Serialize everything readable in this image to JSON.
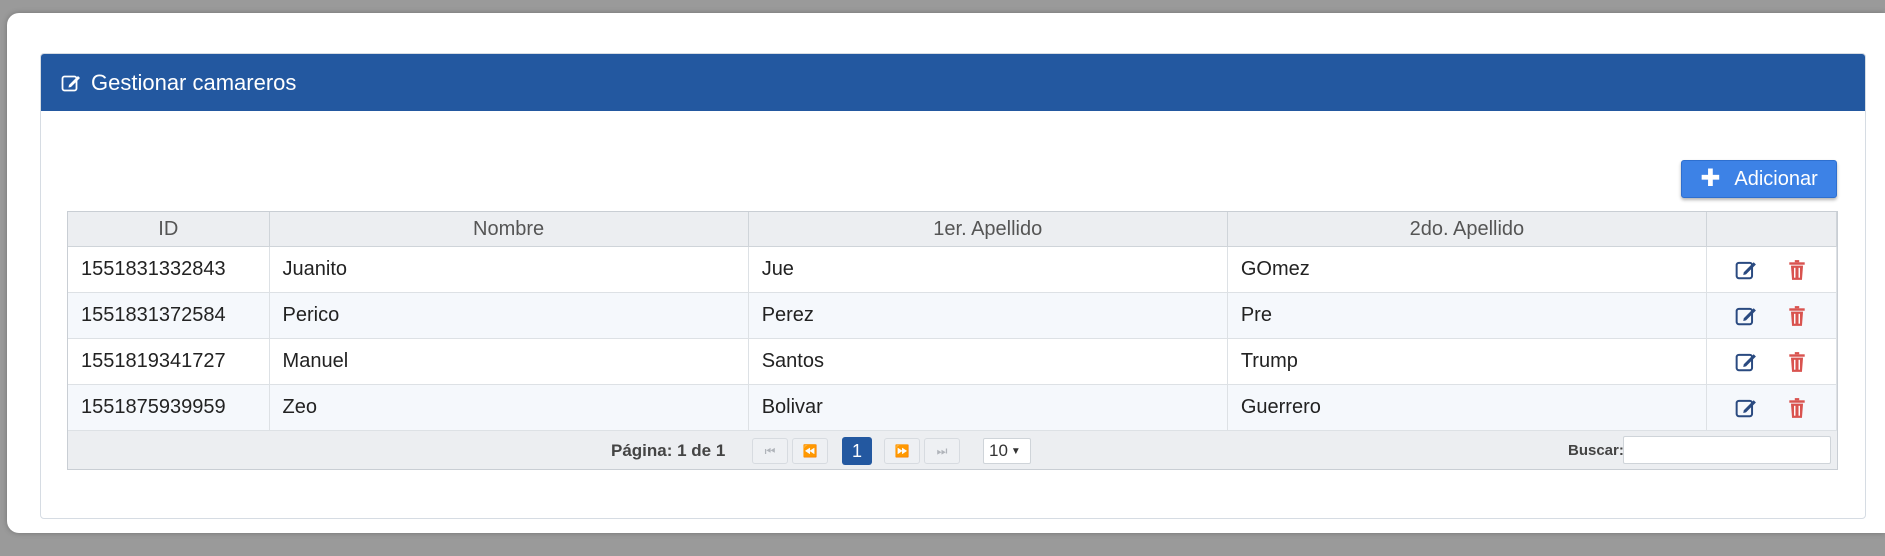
{
  "header": {
    "title": "Gestionar camareros",
    "icon": "edit-icon"
  },
  "toolbar": {
    "add_label": "Adicionar",
    "add_icon": "plus-icon"
  },
  "table": {
    "columns": [
      "ID",
      "Nombre",
      "1er. Apellido",
      "2do. Apellido",
      ""
    ],
    "rows": [
      {
        "id": "1551831332843",
        "nombre": "Juanito",
        "apellido1": "Jue",
        "apellido2": "GOmez"
      },
      {
        "id": "1551831372584",
        "nombre": "Perico",
        "apellido1": "Perez",
        "apellido2": "Pre"
      },
      {
        "id": "1551819341727",
        "nombre": "Manuel",
        "apellido1": "Santos",
        "apellido2": "Trump"
      },
      {
        "id": "1551875939959",
        "nombre": "Zeo",
        "apellido1": "Bolivar",
        "apellido2": "Guerrero"
      }
    ],
    "row_actions": [
      "edit-icon",
      "trash-icon"
    ]
  },
  "pager": {
    "page_info": "Página: 1 de 1",
    "current_page": "1",
    "rows_per_page": "10",
    "search_label": "Buscar:",
    "search_value": ""
  },
  "colors": {
    "header_bg": "#2358a0",
    "add_button": "#3d82e6",
    "delete_icon": "#d9534f"
  }
}
